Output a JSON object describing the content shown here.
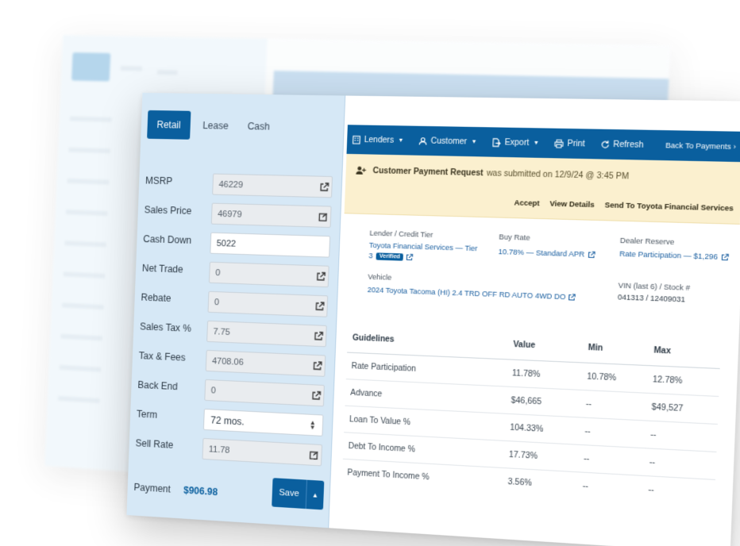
{
  "mode_tabs": [
    {
      "label": "Retail",
      "active": true
    },
    {
      "label": "Lease",
      "active": false
    },
    {
      "label": "Cash",
      "active": false
    }
  ],
  "fields": {
    "msrp": {
      "label": "MSRP",
      "value": "46229"
    },
    "sales_price": {
      "label": "Sales Price",
      "value": "46979"
    },
    "cash_down": {
      "label": "Cash Down",
      "value": "5022"
    },
    "net_trade": {
      "label": "Net Trade",
      "value": "0"
    },
    "rebate": {
      "label": "Rebate",
      "value": "0"
    },
    "sales_tax": {
      "label": "Sales Tax %",
      "value": "7.75"
    },
    "tax_fees": {
      "label": "Tax & Fees",
      "value": "4708.06"
    },
    "back_end": {
      "label": "Back End",
      "value": "0"
    },
    "term": {
      "label": "Term",
      "value": "72 mos."
    },
    "sell_rate": {
      "label": "Sell Rate",
      "value": "11.78"
    }
  },
  "payment": {
    "label": "Payment",
    "value": "$906.98"
  },
  "save_label": "Save",
  "toolbar": {
    "lenders": "Lenders",
    "customer": "Customer",
    "export": "Export",
    "print": "Print",
    "refresh": "Refresh",
    "back": "Back To Payments"
  },
  "notice": {
    "title": "Customer Payment Request",
    "text": "was submitted on 12/9/24 @ 3:45 PM",
    "actions": [
      "Accept",
      "View Details",
      "Send To Toyota Financial Services"
    ]
  },
  "deal": {
    "lender_label": "Lender / Credit Tier",
    "lender_value_1": "Toyota Financial Services — Tier",
    "lender_value_2": "3",
    "verified": "Verified",
    "buy_rate_label": "Buy Rate",
    "buy_rate_value": "10.78% — Standard APR",
    "dealer_reserve_label": "Dealer Reserve",
    "dealer_reserve_value": "Rate Participation — $1,296",
    "vehicle_label": "Vehicle",
    "vehicle_value": "2024 Toyota Tacoma (HI) 2.4 TRD OFF RD AUTO 4WD DO",
    "vin_label": "VIN (last 6) / Stock #",
    "vin_value": "041313 / 12409031"
  },
  "guidelines": {
    "headers": [
      "Guidelines",
      "Value",
      "Min",
      "Max"
    ],
    "rows": [
      [
        "Rate Participation",
        "11.78%",
        "10.78%",
        "12.78%"
      ],
      [
        "Advance",
        "$46,665",
        "--",
        "$49,527"
      ],
      [
        "Loan To Value %",
        "104.33%",
        "--",
        "--"
      ],
      [
        "Debt To Income %",
        "17.73%",
        "--",
        "--"
      ],
      [
        "Payment To Income %",
        "3.56%",
        "--",
        "--"
      ]
    ]
  },
  "colors": {
    "primary": "#0a5f9e",
    "panel": "#d6e8f6",
    "notice": "#fbf0cf"
  },
  "icons": {
    "edit": "external-link-icon",
    "notice": "user-plus-icon"
  }
}
